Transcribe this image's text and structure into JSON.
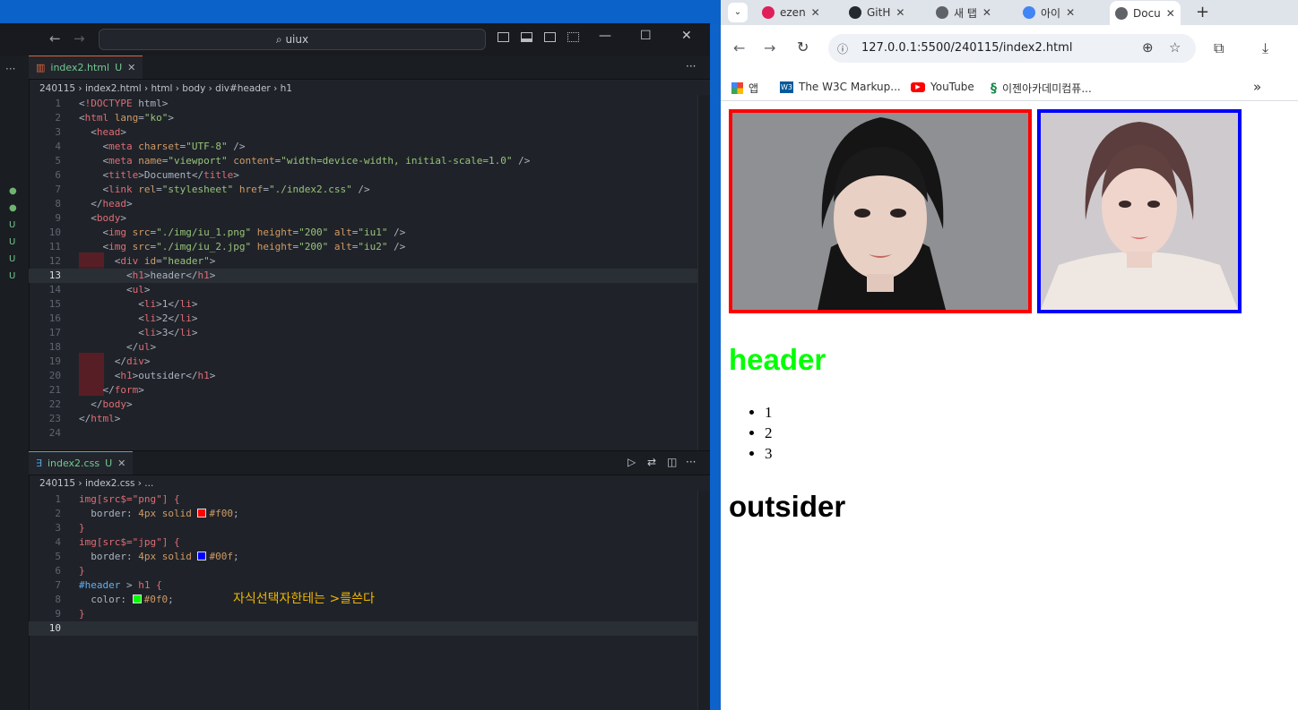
{
  "vscode": {
    "search": "uiux",
    "html_tab": {
      "name": "index2.html",
      "status": "U"
    },
    "html_breadcrumb": [
      "240115",
      "index2.html",
      "html",
      "body",
      "div#header",
      "h1"
    ],
    "html_lines": [
      {
        "n": "1",
        "text": "<!DOCTYPE html>"
      },
      {
        "n": "2",
        "text": "<html lang=\"ko\">"
      },
      {
        "n": "3",
        "text": "  <head>"
      },
      {
        "n": "4",
        "text": "    <meta charset=\"UTF-8\" />"
      },
      {
        "n": "5",
        "text": "    <meta name=\"viewport\" content=\"width=device-width, initial-scale=1.0\" />"
      },
      {
        "n": "6",
        "text": "    <title>Document</title>"
      },
      {
        "n": "7",
        "text": "    <link rel=\"stylesheet\" href=\"./index2.css\" />"
      },
      {
        "n": "8",
        "text": "  </head>"
      },
      {
        "n": "9",
        "text": "  <body>"
      },
      {
        "n": "10",
        "text": "    <img src=\"./img/iu_1.png\" height=\"200\" alt=\"iu1\" />"
      },
      {
        "n": "11",
        "text": "    <img src=\"./img/iu_2.jpg\" height=\"200\" alt=\"iu2\" />"
      },
      {
        "n": "12",
        "text": "      <div id=\"header\">"
      },
      {
        "n": "13",
        "text": "        <h1>header</h1>"
      },
      {
        "n": "14",
        "text": "        <ul>"
      },
      {
        "n": "15",
        "text": "          <li>1</li>"
      },
      {
        "n": "16",
        "text": "          <li>2</li>"
      },
      {
        "n": "17",
        "text": "          <li>3</li>"
      },
      {
        "n": "18",
        "text": "        </ul>"
      },
      {
        "n": "19",
        "text": "      </div>"
      },
      {
        "n": "20",
        "text": "      <h1>outsider</h1>"
      },
      {
        "n": "21",
        "text": "    </form>"
      },
      {
        "n": "22",
        "text": "  </body>"
      },
      {
        "n": "23",
        "text": "</html>"
      },
      {
        "n": "24",
        "text": ""
      }
    ],
    "css_tab": {
      "name": "index2.css",
      "status": "U"
    },
    "css_breadcrumb": [
      "240115",
      "index2.css",
      "..."
    ],
    "css_lines": [
      {
        "n": "1",
        "text": "img[src$=\"png\"] {"
      },
      {
        "n": "2",
        "text": "  border: 4px solid #f00;"
      },
      {
        "n": "3",
        "text": "}"
      },
      {
        "n": "4",
        "text": "img[src$=\"jpg\"] {"
      },
      {
        "n": "5",
        "text": "  border: 4px solid #00f;"
      },
      {
        "n": "6",
        "text": "}"
      },
      {
        "n": "7",
        "text": "#header > h1 {"
      },
      {
        "n": "8",
        "text": "  color: #0f0;"
      },
      {
        "n": "9",
        "text": "}"
      },
      {
        "n": "10",
        "text": ""
      }
    ],
    "annotation": "자식선택자한테는  >를쓴다",
    "gutter_marks": [
      "●",
      "●",
      "U",
      "U",
      "U",
      "U"
    ]
  },
  "chrome": {
    "tabs": [
      {
        "label": "ezen",
        "color": "#e01e5a"
      },
      {
        "label": "GitH",
        "color": "#24292f"
      },
      {
        "label": "새 탭",
        "color": "#5f6368"
      },
      {
        "label": "아이",
        "color": "#4285f4"
      },
      {
        "label": "Docu",
        "color": "#5f6368"
      }
    ],
    "url": "127.0.0.1:5500/240115/index2.html",
    "bookmarks": [
      {
        "label": "앱"
      },
      {
        "label": "The W3C Markup..."
      },
      {
        "label": "YouTube"
      },
      {
        "label": "이젠아카데미컴퓨..."
      }
    ],
    "page": {
      "h1_header": "header",
      "list": [
        "1",
        "2",
        "3"
      ],
      "h1_outsider": "outsider",
      "img1_alt": "iu1",
      "img2_alt": "iu2"
    }
  },
  "colors": {
    "red_border": "#f00",
    "blue_border": "#00f",
    "green_text": "#0f0"
  }
}
